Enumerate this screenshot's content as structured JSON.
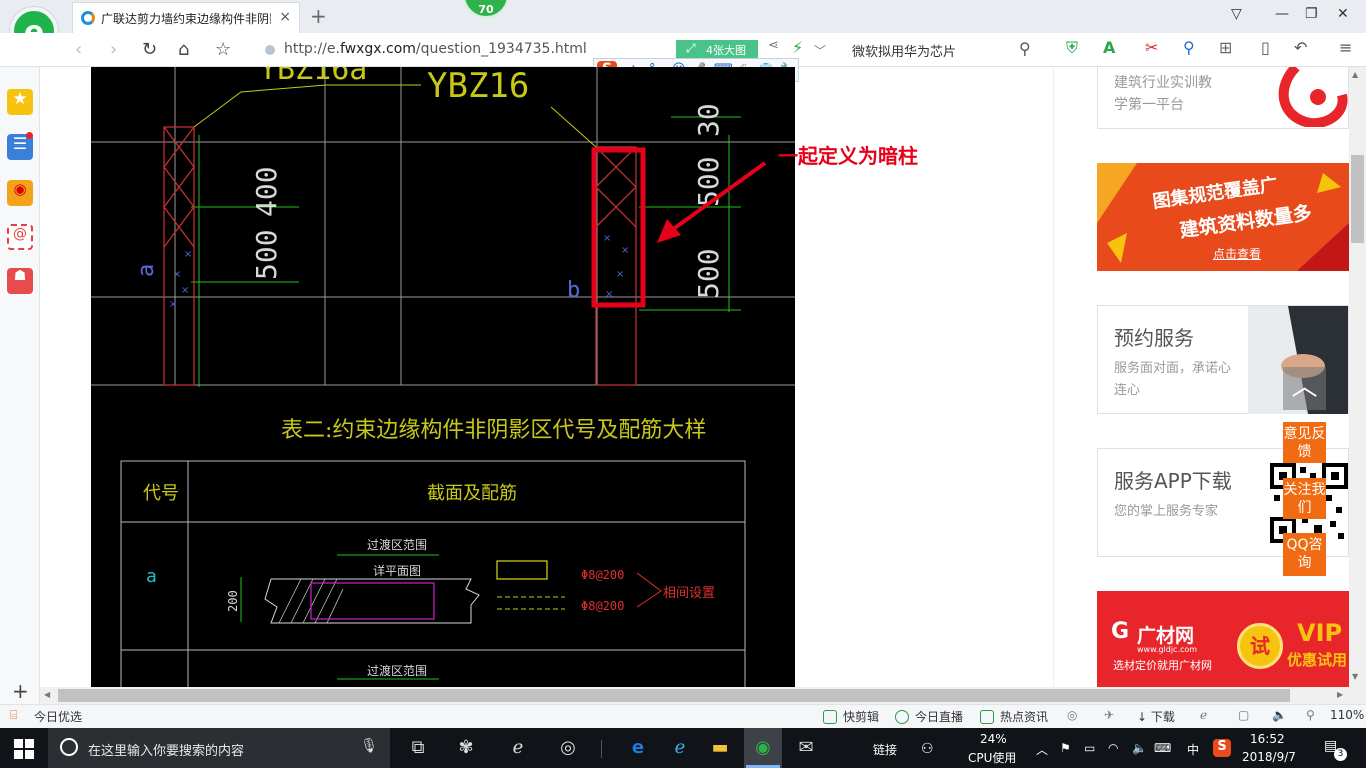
{
  "browser": {
    "tab_title": "广联达剪力墙约束边缘构件非阴影",
    "tab_close": "×",
    "new_tab": "+",
    "badge": "70",
    "url_prefix": "http://e.",
    "url_domain": "fwxgx.com",
    "url_path": "/question_1934735.html",
    "big_image_label": "4张大图",
    "search_hint": "微软拟用华为芯片",
    "window_controls": [
      "▽",
      "—",
      "❐",
      "✕"
    ]
  },
  "ime": {
    "logo": "S",
    "mode": "中",
    "punct": "°,",
    "items": [
      "☺",
      "🎤",
      "⌨",
      "⎙",
      "👕",
      "🔧"
    ]
  },
  "cad": {
    "label_ybz_left": "YBZ16a",
    "label_ybz": "YBZ16",
    "dims_left": [
      "400",
      "500"
    ],
    "dims_right": [
      "30",
      "500",
      "500"
    ],
    "label_a": "a",
    "label_b": "b",
    "table_title": "表二:约束边缘构件非阴影区代号及配筋大样",
    "col_code": "代号",
    "col_section": "截面及配筋",
    "row_code": "a",
    "transition_label": "过渡区范围",
    "plan_label": "详平面图",
    "dim_200": "200",
    "rebar1": "Φ8@200",
    "rebar2": "Φ8@200",
    "note_interval": "相间设置",
    "transition_label2": "过渡区范围"
  },
  "annotation": "一起定义为暗柱",
  "sidebar_right": {
    "card0_line1": "建筑行业实训教",
    "card0_line2": "学第一平台",
    "banner1_line1": "图集规范覆盖广",
    "banner1_line2": "建筑资料数量多",
    "banner1_cta": "点击查看",
    "card1_title": "预约服务",
    "card1_desc": "服务面对面，承诺心连心",
    "card2_title": "服务APP下载",
    "card2_desc": "您的掌上服务专家",
    "banner2_brand": "广材网",
    "banner2_domain": "www.gldjc.com",
    "banner2_slogan": "选材定价就用广材网",
    "banner2_try": "试",
    "banner2_vip": "VIP",
    "banner2_vip_sub": "优惠试用",
    "float_top": "︿",
    "float_feedback": "意见反馈",
    "float_follow": "关注我们",
    "float_qq": "QQ咨询"
  },
  "statusbar": {
    "left": "今日优选",
    "items": [
      "快剪辑",
      "今日直播",
      "热点资讯"
    ],
    "download": "下载",
    "zoom": "110%"
  },
  "taskbar": {
    "search_placeholder": "在这里输入你要搜索的内容",
    "link_label": "链接",
    "cpu_percent": "24%",
    "cpu_label": "CPU使用",
    "ime_lang": "中",
    "time": "16:52",
    "date": "2018/9/7",
    "notif_count": "3"
  },
  "colors": {
    "cad_yellow": "#c8c818",
    "cad_green": "#20c020",
    "cad_red": "#c03030",
    "cad_cyan": "#20c0c0",
    "cad_magenta": "#c020c0",
    "highlight_red": "#e6001a",
    "orange_accent": "#f06b12"
  }
}
